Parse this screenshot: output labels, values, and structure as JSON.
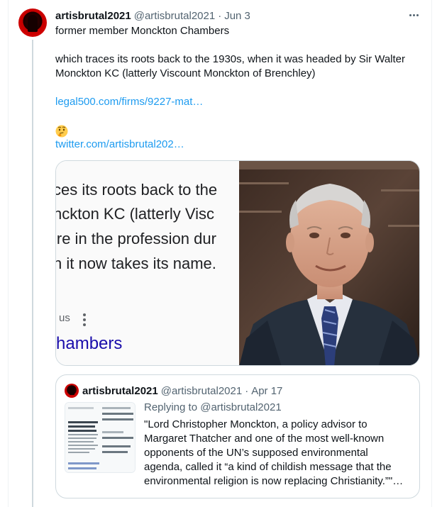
{
  "tweet": {
    "author_name": "artisbrutal2021",
    "author_handle": "@artisbrutal2021",
    "separator": "·",
    "date": "Jun 3",
    "lines": [
      "former member Monckton Chambers",
      "which traces its roots back to the 1930s, when it was headed by Sir Walter",
      "Monckton KC (latterly Viscount Monckton of Brenchley)"
    ],
    "link1": "legal500.com/firms/9227-mat…",
    "emoji": "thinking-face-emoji",
    "link2": "twitter.com/artisbrutal202…"
  },
  "media": {
    "screenshot_lines": [
      "ces its roots back to the",
      "nckton KC (latterly Visc",
      "ire in the profession dur",
      "n it now takes its name."
    ],
    "small_text": "us",
    "blue_text": "hambers"
  },
  "quote": {
    "author_name": "artisbrutal2021",
    "author_handle": "@artisbrutal2021",
    "separator": "·",
    "date": "Apr 17",
    "replying_to": "Replying to @artisbrutal2021",
    "lines": [
      "\"Lord Christopher Monckton, a policy advisor to",
      "Margaret Thatcher and one of the most well-known",
      "opponents of  the UN’s supposed environmental",
      "agenda, called it “a kind of childish message that the",
      "environmental religion is now replacing Christianity.”\"…"
    ]
  },
  "colors": {
    "link": "#1d9bf0",
    "text": "#0f1419",
    "secondary": "#536471",
    "border": "#cfd9de",
    "avatar": "#e10000"
  },
  "icons": [
    "more-icon",
    "thinking-face-emoji"
  ]
}
